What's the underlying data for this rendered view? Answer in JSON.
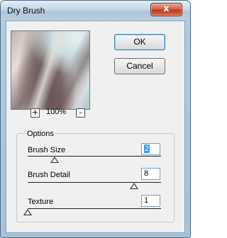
{
  "window": {
    "title": "Dry Brush",
    "close_glyph": "x"
  },
  "preview": {
    "zoom_minus_glyph": "+",
    "zoom_level": "100%",
    "zoom_plus_glyph": "-"
  },
  "buttons": {
    "ok_label": "OK",
    "cancel_label": "Cancel"
  },
  "options": {
    "legend": "Options",
    "params": [
      {
        "label": "Brush Size",
        "value": "2",
        "max": 10
      },
      {
        "label": "Brush Detail",
        "value": "8",
        "max": 10
      },
      {
        "label": "Texture",
        "value": "1",
        "max": 3,
        "min": 1
      }
    ]
  }
}
